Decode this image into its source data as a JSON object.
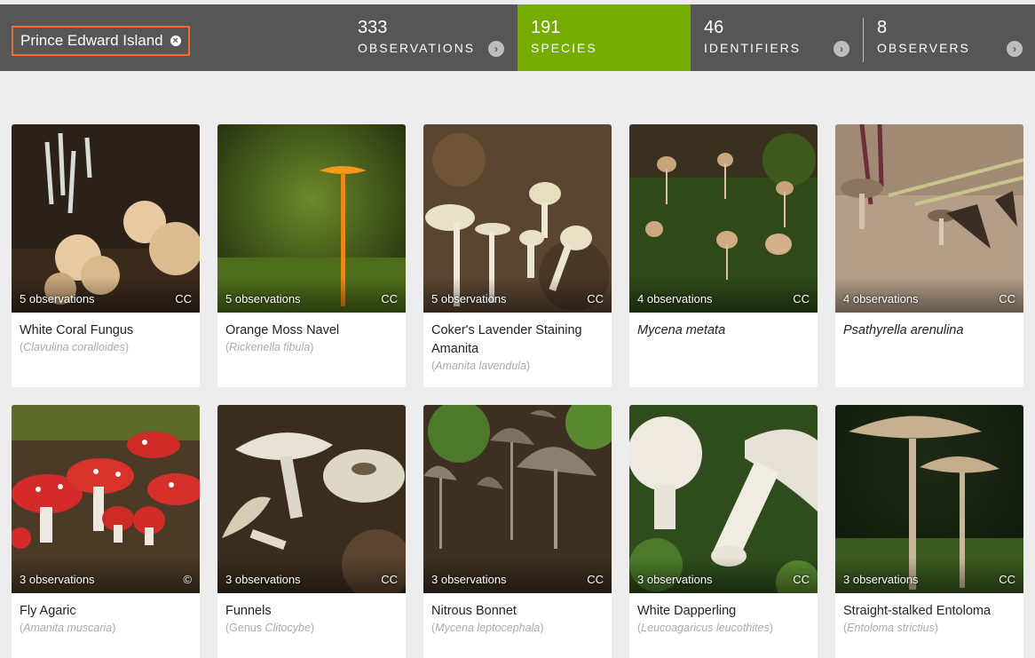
{
  "header": {
    "place": "Prince Edward Island",
    "stats": [
      {
        "count": "333",
        "label": "OBSERVATIONS",
        "active": false
      },
      {
        "count": "191",
        "label": "SPECIES",
        "active": true
      },
      {
        "count": "46",
        "label": "IDENTIFIERS",
        "active": false
      },
      {
        "count": "8",
        "label": "OBSERVERS",
        "active": false
      }
    ],
    "arrow_icon": "chevron-right-icon"
  },
  "species": [
    {
      "common": "White Coral Fungus",
      "scientific": "Clavulina coralloides",
      "sci_prefix": "",
      "observations": "5 observations",
      "license": "CC"
    },
    {
      "common": "Orange Moss Navel",
      "scientific": "Rickenella fibula",
      "sci_prefix": "",
      "observations": "5 observations",
      "license": "CC"
    },
    {
      "common": "Coker's Lavender Staining Amanita",
      "scientific": "Amanita lavendula",
      "sci_prefix": "",
      "observations": "5 observations",
      "license": "CC"
    },
    {
      "common": "Mycena metata",
      "scientific": "",
      "sci_prefix": "",
      "observations": "4 observations",
      "license": "CC"
    },
    {
      "common": "Psathyrella arenulina",
      "scientific": "",
      "sci_prefix": "",
      "observations": "4 observations",
      "license": "CC"
    },
    {
      "common": "Fly Agaric",
      "scientific": "Amanita muscaria",
      "sci_prefix": "",
      "observations": "3 observations",
      "license": "©"
    },
    {
      "common": "Funnels",
      "scientific": "Clitocybe",
      "sci_prefix": "Genus ",
      "observations": "3 observations",
      "license": "CC"
    },
    {
      "common": "Nitrous Bonnet",
      "scientific": "Mycena leptocephala",
      "sci_prefix": "",
      "observations": "3 observations",
      "license": "CC"
    },
    {
      "common": "White Dapperling",
      "scientific": "Leucoagaricus leucothites",
      "sci_prefix": "",
      "observations": "3 observations",
      "license": "CC"
    },
    {
      "common": "Straight-stalked Entoloma",
      "scientific": "Entoloma strictius",
      "sci_prefix": "",
      "observations": "3 observations",
      "license": "CC"
    }
  ],
  "colors": {
    "header_bg": "#565656",
    "active_tab": "#74ac00",
    "place_border": "#f06a35",
    "page_bg": "#ededed"
  }
}
